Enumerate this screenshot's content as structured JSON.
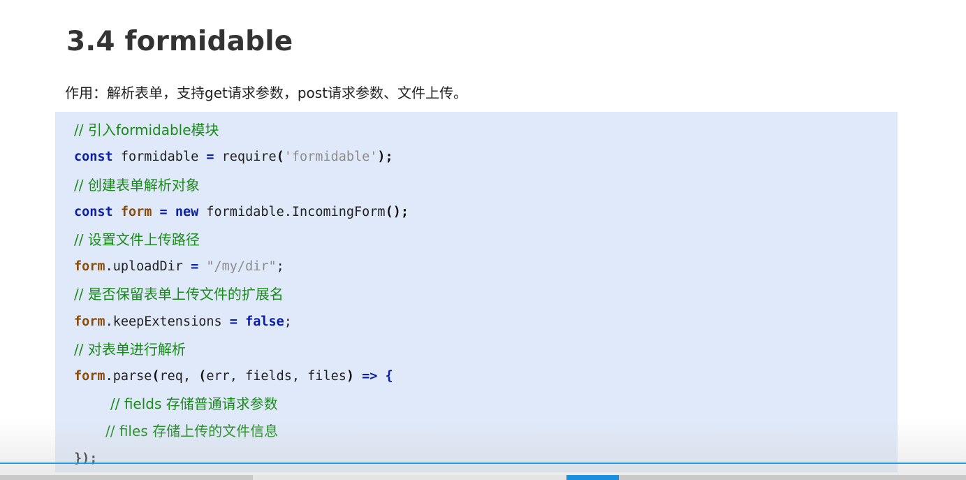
{
  "slide": {
    "title": "3.4 formidable",
    "description": "作用：解析表单，支持get请求参数，post请求参数、文件上传。"
  },
  "code": {
    "c1": "// 引入formidable模块",
    "l2_const": "const",
    "l2_rest1": " formidable ",
    "l2_eq": "=",
    "l2_rest2": " require",
    "l2_paren_open": "(",
    "l2_str": "'formidable'",
    "l2_paren_close": ");",
    "c3": "// 创建表单解析对象",
    "l4_const": "const",
    "l4_form": "form",
    "l4_eq": "=",
    "l4_new": "new",
    "l4_rest": " formidable.IncomingForm",
    "l4_paren": "();",
    "c5": "// 设置文件上传路径",
    "l6_form": "form",
    "l6_rest": ".uploadDir ",
    "l6_eq": "=",
    "l6_str": "\"/my/dir\"",
    "l6_end": ";",
    "c7": "// 是否保留表单上传文件的扩展名",
    "l8_form": "form",
    "l8_rest": ".keepExtensions ",
    "l8_eq": "=",
    "l8_false": "false",
    "l8_end": ";",
    "c9": "// 对表单进行解析",
    "l10_form": "form",
    "l10_rest1": ".parse",
    "l10_p1": "(",
    "l10_rest2": "req, ",
    "l10_p2": "(",
    "l10_rest3": "err, fields, files",
    "l10_p3": ")",
    "l10_arrow": " => {",
    "c11": "// fields 存储普通请求参数",
    "c12": "// files 存储上传的文件信息",
    "l13": "});"
  },
  "player": {
    "accent_color": "#1f9be0"
  }
}
